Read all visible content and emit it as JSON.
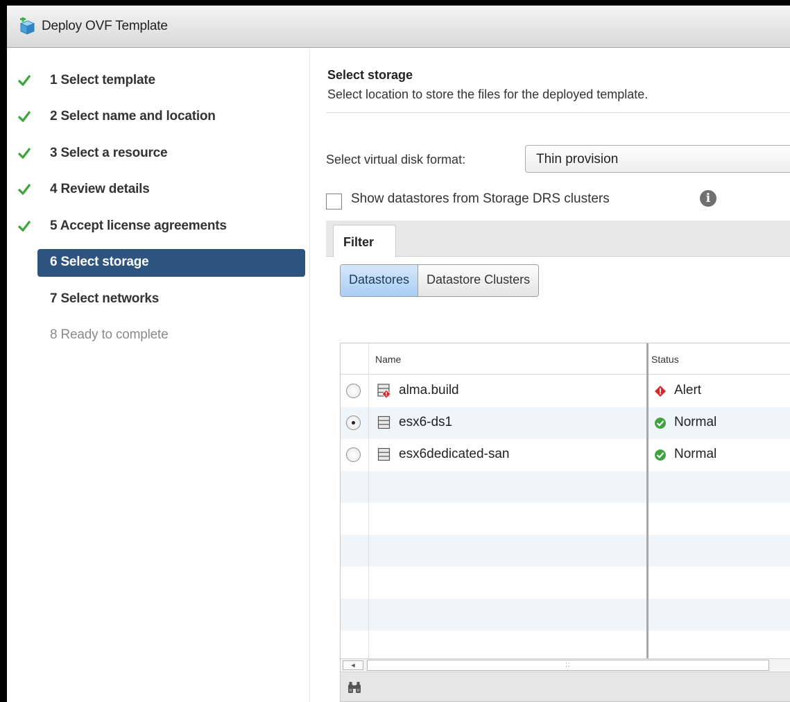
{
  "window": {
    "title": "Deploy OVF Template",
    "title_icon": "ovf-package-icon"
  },
  "steps": [
    {
      "number": "1",
      "label": "Select template",
      "state": "done"
    },
    {
      "number": "2",
      "label": "Select name and location",
      "state": "done"
    },
    {
      "number": "3",
      "label": "Select a resource",
      "state": "done"
    },
    {
      "number": "4",
      "label": "Review details",
      "state": "done"
    },
    {
      "number": "5",
      "label": "Accept license agreements",
      "state": "done"
    },
    {
      "number": "6",
      "label": "Select storage",
      "state": "active"
    },
    {
      "number": "7",
      "label": "Select networks",
      "state": "pending"
    },
    {
      "number": "8",
      "label": "Ready to complete",
      "state": "future"
    }
  ],
  "step_texts": {
    "s1": "1  Select template",
    "s2": "2  Select name and location",
    "s3": "3  Select a resource",
    "s4": "4  Review details",
    "s5": "5  Accept license agreements",
    "s6": "6  Select storage",
    "s7": "7  Select networks",
    "s8": "8  Ready to complete"
  },
  "page": {
    "heading": "Select storage",
    "subheading": "Select location to store the files for the deployed template."
  },
  "disk_format": {
    "label": "Select virtual disk format:",
    "value": "Thin provision"
  },
  "drs_option": {
    "label": "Show datastores from Storage DRS clusters",
    "checked": false,
    "info_icon": "info-icon"
  },
  "tabs": {
    "filter": "Filter"
  },
  "toggle": {
    "datastores": "Datastores",
    "clusters": "Datastore Clusters",
    "selected": "Datastores"
  },
  "table": {
    "columns": {
      "name": "Name",
      "status": "Status"
    },
    "rows": [
      {
        "name": "alma.build",
        "status": "Alert",
        "selected": false,
        "status_icon": "alert-icon"
      },
      {
        "name": "esx6-ds1",
        "status": "Normal",
        "selected": true,
        "status_icon": "ok-icon"
      },
      {
        "name": "esx6dedicated-san",
        "status": "Normal",
        "selected": false,
        "status_icon": "ok-icon"
      }
    ],
    "scroll_arrow": "◄",
    "scroll_grip": "::"
  },
  "colors": {
    "active_step": "#2d537f",
    "check": "#3aa63a",
    "alert": "#d9252a",
    "ok": "#3ea43e",
    "row_alt": "#f0f5fa"
  }
}
